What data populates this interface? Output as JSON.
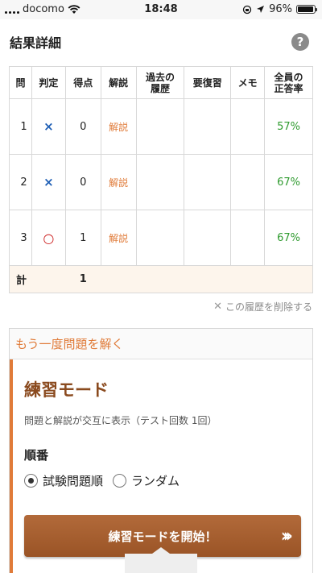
{
  "status_bar": {
    "carrier": "docomo",
    "time": "18:48",
    "battery_percent_label": "96%",
    "battery_level": 0.96,
    "icons": [
      "signal-icon",
      "wifi-icon",
      "lock-rotation-icon",
      "location-icon",
      "battery-icon"
    ]
  },
  "results": {
    "title": "結果詳細",
    "help_icon": "?",
    "columns": [
      "問",
      "判定",
      "得点",
      "解説",
      "過去の履歴",
      "要復習",
      "メモ",
      "全員の正答率"
    ],
    "column_lines": {
      "history": [
        "過去の",
        "履歴"
      ],
      "rate": [
        "全員の",
        "正答率"
      ]
    },
    "rows": [
      {
        "no": "1",
        "mark": "×",
        "score": "0",
        "explain": "解説",
        "history": "",
        "review": "",
        "memo": "",
        "rate": "57%"
      },
      {
        "no": "2",
        "mark": "×",
        "score": "0",
        "explain": "解説",
        "history": "",
        "review": "",
        "memo": "",
        "rate": "67%"
      },
      {
        "no": "3",
        "mark": "○",
        "score": "1",
        "explain": "解説",
        "history": "",
        "review": "",
        "memo": "",
        "rate": "67%"
      }
    ],
    "total_label": "計",
    "total_score": "1",
    "delete_history": "この履歴を削除する"
  },
  "retry": {
    "header": "もう一度問題を解く",
    "mode_title": "練習モード",
    "mode_description": "問題と解説が交互に表示（テスト回数 1回）",
    "order_label": "順番",
    "order_options": [
      {
        "label": "試験問題順",
        "checked": true
      },
      {
        "label": "ランダム",
        "checked": false
      }
    ],
    "start_button": "練習モードを開始！"
  },
  "colors": {
    "accent": "#e07b39",
    "button_brown": "#a85e2e",
    "wrong_mark": "#1f5fb5",
    "correct_mark": "#cc1f1f",
    "rate_green": "#2f9b2f"
  }
}
